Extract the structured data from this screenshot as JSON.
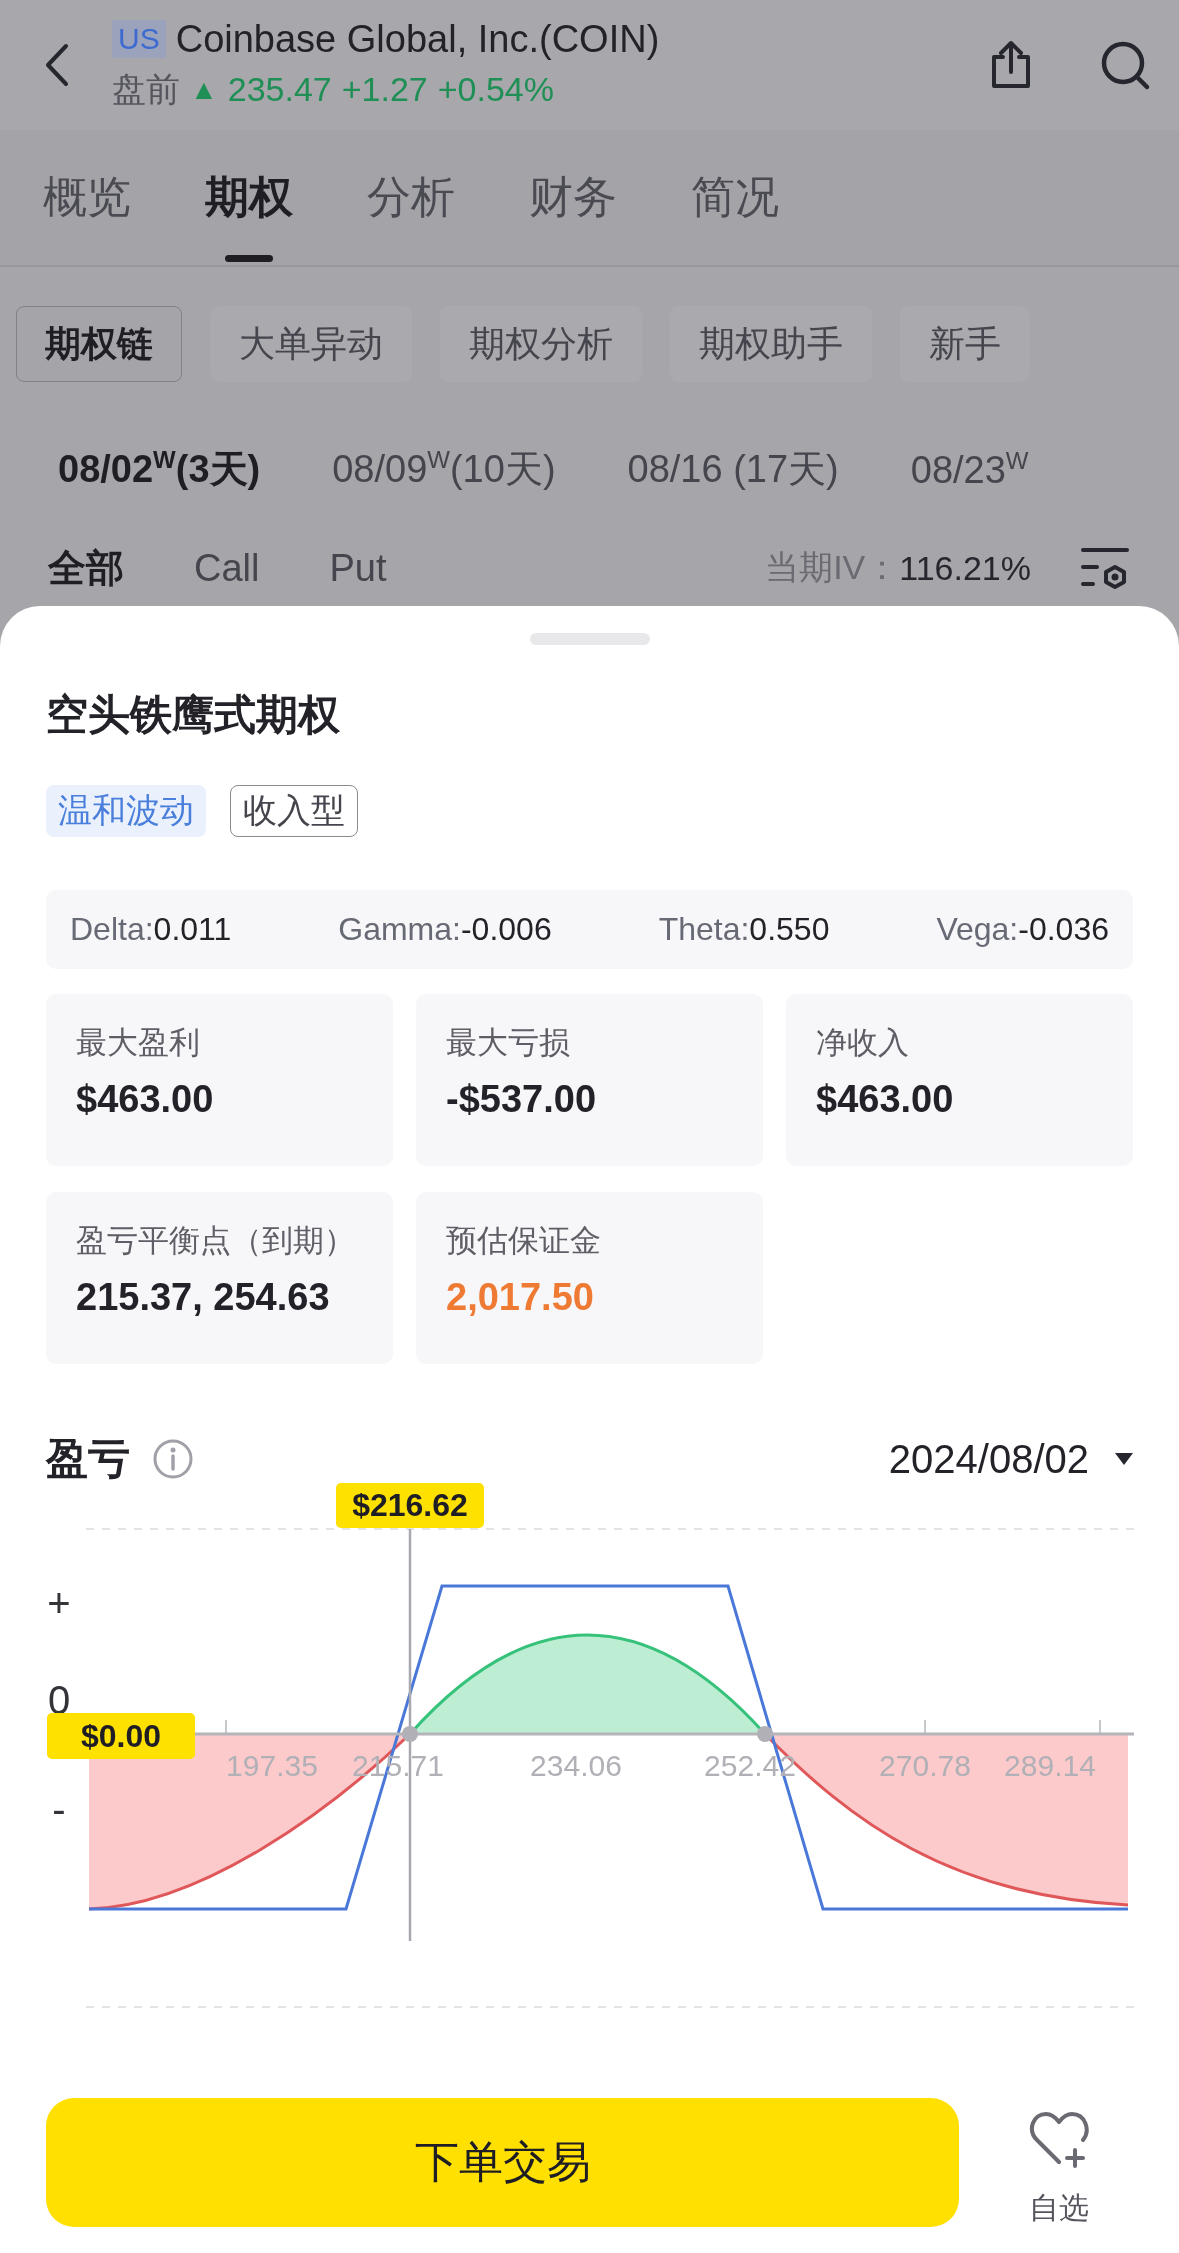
{
  "header": {
    "market_badge": "US",
    "title": "Coinbase Global, Inc.(COIN)",
    "session": "盘前",
    "trend_icon": "▲",
    "price": "235.47",
    "change": "+1.27",
    "change_pct": "+0.54%"
  },
  "tabs": [
    {
      "label": "概览",
      "selected": false
    },
    {
      "label": "期权",
      "selected": true
    },
    {
      "label": "分析",
      "selected": false
    },
    {
      "label": "财务",
      "selected": false
    },
    {
      "label": "简况",
      "selected": false
    }
  ],
  "sub_tabs": [
    {
      "label": "期权链",
      "selected": true
    },
    {
      "label": "大单异动",
      "selected": false
    },
    {
      "label": "期权分析",
      "selected": false
    },
    {
      "label": "期权助手",
      "selected": false
    },
    {
      "label": "新手",
      "selected": false
    }
  ],
  "expiries": [
    {
      "label": "08/02$^{W}$(3天)",
      "selected": true
    },
    {
      "label": "08/09$^{W}$(10天)",
      "selected": false
    },
    {
      "label": "08/16 (17天)",
      "selected": false
    },
    {
      "label": "08/23$^{W}$",
      "selected": false
    }
  ],
  "filters": [
    {
      "label": "全部",
      "selected": true
    },
    {
      "label": "Call",
      "selected": false
    },
    {
      "label": "Put",
      "selected": false
    }
  ],
  "iv": {
    "label": "当期IV：",
    "value": "116.21%"
  },
  "sheet": {
    "title": "空头铁鹰式期权",
    "tags": [
      {
        "label": "温和波动",
        "kind": "filled"
      },
      {
        "label": "收入型",
        "kind": "outline"
      }
    ],
    "greeks": [
      {
        "name": "Delta:",
        "value": "0.011"
      },
      {
        "name": "Gamma:",
        "value": "-0.006"
      },
      {
        "name": "Theta:",
        "value": "0.550"
      },
      {
        "name": "Vega:",
        "value": "-0.036"
      }
    ],
    "stats": [
      {
        "label": "最大盈利",
        "value": "$463.00",
        "kind": "normal"
      },
      {
        "label": "最大亏损",
        "value": "-$537.00",
        "kind": "normal"
      },
      {
        "label": "净收入",
        "value": "$463.00",
        "kind": "normal"
      },
      {
        "label": "盈亏平衡点（到期）",
        "value": "215.37, 254.63",
        "kind": "normal"
      },
      {
        "label": "预估保证金",
        "value": "2,017.50",
        "kind": "highlight"
      }
    ]
  },
  "pnl": {
    "title": "盈亏",
    "date": "2024/08/02",
    "y_labels": [
      "+",
      "0",
      "-"
    ],
    "x_labels": [
      "197.35",
      "215.71",
      "234.06",
      "252.42",
      "270.78",
      "289.14"
    ],
    "cursor_label": "$216.62",
    "zero_label": "$0.00"
  },
  "actions": {
    "trade_button": "下单交易",
    "watch_label": "自选"
  }
}
